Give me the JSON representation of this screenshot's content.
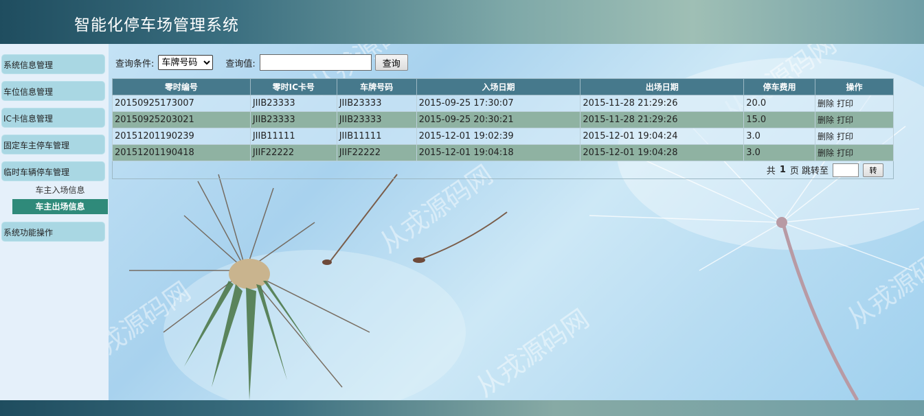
{
  "header": {
    "title": "智能化停车场管理系统"
  },
  "sidebar": {
    "items": [
      {
        "label": "系统信息管理"
      },
      {
        "label": "车位信息管理"
      },
      {
        "label": "IC卡信息管理"
      },
      {
        "label": "固定车主停车管理"
      },
      {
        "label": "临时车辆停车管理"
      },
      {
        "label": "系统功能操作"
      }
    ],
    "sub_items": [
      {
        "label": "车主入场信息",
        "active": false
      },
      {
        "label": "车主出场信息",
        "active": true
      }
    ]
  },
  "search": {
    "condition_label": "查询条件:",
    "condition_selected": "车牌号码",
    "value_label": "查询值:",
    "value": "",
    "button_label": "查询"
  },
  "table": {
    "columns": [
      "零时编号",
      "零时IC卡号",
      "车牌号码",
      "入场日期",
      "出场日期",
      "停车费用",
      "操作"
    ],
    "rows": [
      [
        "20150925173007",
        "JIIB23333",
        "JIIB23333",
        "2015-09-25 17:30:07",
        "2015-11-28 21:29:26",
        "20.0"
      ],
      [
        "20150925203021",
        "JIIB23333",
        "JIIB23333",
        "2015-09-25 20:30:21",
        "2015-11-28 21:29:26",
        "15.0"
      ],
      [
        "20151201190239",
        "JIIB11111",
        "JIIB11111",
        "2015-12-01 19:02:39",
        "2015-12-01 19:04:24",
        "3.0"
      ],
      [
        "20151201190418",
        "JIIF22222",
        "JIIF22222",
        "2015-12-01 19:04:18",
        "2015-12-01 19:04:28",
        "3.0"
      ]
    ],
    "action_delete": "删除",
    "action_print": "打印"
  },
  "pager": {
    "total_prefix": "共",
    "total_pages": "1",
    "total_suffix": "页 跳转至",
    "go_button": "转"
  },
  "watermark": "从戎源码网",
  "colors": {
    "header_dark": "#1f4d5f",
    "table_header": "#46798c",
    "row_alt": "#8fb2a2",
    "active_sub": "#2f8a7a",
    "menu_item": "#a9d7e3"
  }
}
